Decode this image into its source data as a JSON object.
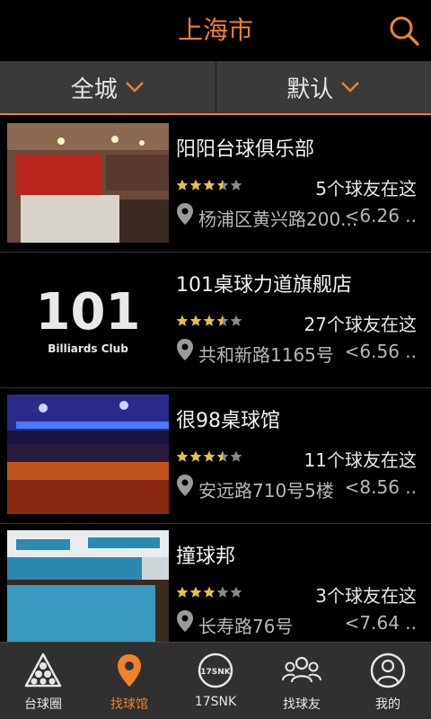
{
  "header": {
    "title": "上海市",
    "search_icon": "search-icon",
    "accent": "#f0822a"
  },
  "filters": [
    {
      "label": "全城",
      "icon": "chevron-down-icon"
    },
    {
      "label": "默认",
      "icon": "chevron-down-icon"
    }
  ],
  "venues": [
    {
      "name": "阳阳台球俱乐部",
      "rating": 3.5,
      "friends": "5个球友在这",
      "address": "杨浦区黄兴路200...",
      "distance": "<6.26 .."
    },
    {
      "name": "101桌球力道旗舰店",
      "rating": 3.5,
      "friends": "27个球友在这",
      "address": "共和新路1165号",
      "distance": "<6.56 ..",
      "logo_text": "101",
      "logo_subtext": "Billiards Club"
    },
    {
      "name": "很98桌球馆",
      "rating": 3.5,
      "friends": "11个球友在这",
      "address": "安远路710号5楼",
      "distance": "<8.56 .."
    },
    {
      "name": "撞球邦",
      "rating": 3,
      "friends": "3个球友在这",
      "address": "长寿路76号",
      "distance": "<7.64 .."
    }
  ],
  "nav": [
    {
      "label": "台球圈",
      "icon": "billiard-rack-icon",
      "active": false
    },
    {
      "label": "找球馆",
      "icon": "location-pin-icon",
      "active": true
    },
    {
      "label": "17SNK",
      "icon": "snk-logo-icon",
      "active": false,
      "icon_text": "17SNK"
    },
    {
      "label": "找球友",
      "icon": "friends-group-icon",
      "active": false
    },
    {
      "label": "我的",
      "icon": "user-profile-icon",
      "active": false
    }
  ]
}
